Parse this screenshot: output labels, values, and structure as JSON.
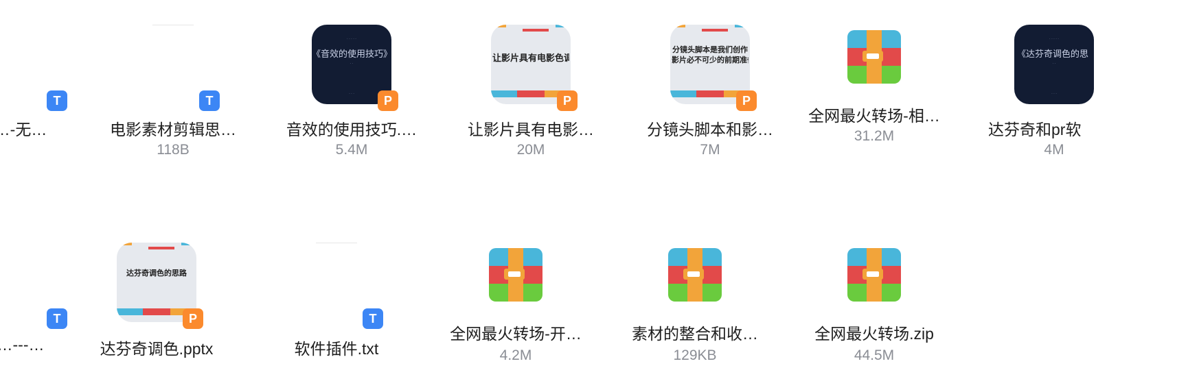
{
  "files": [
    {
      "name": "…-无…",
      "size": ""
    },
    {
      "name": "电影素材剪辑思…",
      "size": "118B",
      "badge": "T"
    },
    {
      "name": "音效的使用技巧.…",
      "size": "5.4M",
      "badge": "P",
      "thumb_title": "《音效的使用技巧》"
    },
    {
      "name": "让影片具有电影…",
      "size": "20M",
      "badge": "P",
      "thumb_text": "让影片具有电影色调"
    },
    {
      "name": "分镜头脚本和影…",
      "size": "7M",
      "badge": "P",
      "thumb_line1": "分镜头脚本是我们创作",
      "thumb_line2": "影片必不可少的前期准备"
    },
    {
      "name": "全网最火转场-相…",
      "size": "31.2M"
    },
    {
      "name": "达芬奇和pr软",
      "size": "4M",
      "thumb_title": "《达芬奇调色的思"
    },
    {
      "name": "…---…",
      "size": "",
      "badge": "T"
    },
    {
      "name": "达芬奇调色.pptx",
      "size": "",
      "badge": "P",
      "thumb_text": "达芬奇调色的思路"
    },
    {
      "name": "软件插件.txt",
      "size": "",
      "badge": "T"
    },
    {
      "name": "全网最火转场-开…",
      "size": "4.2M"
    },
    {
      "name": "素材的整合和收…",
      "size": "129KB"
    },
    {
      "name": "全网最火转场.zip",
      "size": "44.5M"
    }
  ],
  "colors": {
    "ppt_badge": "#fb8a2d",
    "txt_badge": "#3c86f5",
    "dark_thumb": "#121c33",
    "file_name": "#1e1e1e",
    "file_size": "#8a8d94"
  },
  "icons": {
    "ppt_badge": "ppt-file-icon",
    "txt_badge": "txt-file-icon",
    "zip": "zip-archive-icon"
  }
}
